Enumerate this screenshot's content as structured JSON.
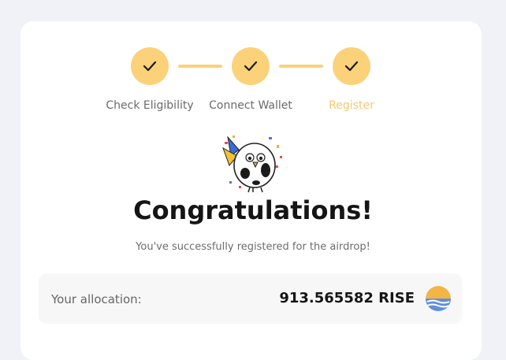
{
  "steps": [
    {
      "label": "Check Eligibility",
      "state": "complete"
    },
    {
      "label": "Connect Wallet",
      "state": "complete"
    },
    {
      "label": "Register",
      "state": "current"
    }
  ],
  "mascot_icon": "celebrating-bird-mascot-icon",
  "title": "Congratulations!",
  "subtitle": "You've successfully registered for the airdrop!",
  "allocation": {
    "label": "Your allocation:",
    "value": "913.565582 RISE",
    "token_icon": "rise-token-icon"
  },
  "colors": {
    "accent": "#fbd17a",
    "accent_text": "#f5c872",
    "card_bg": "#ffffff",
    "page_bg": "#f1f2f8"
  }
}
